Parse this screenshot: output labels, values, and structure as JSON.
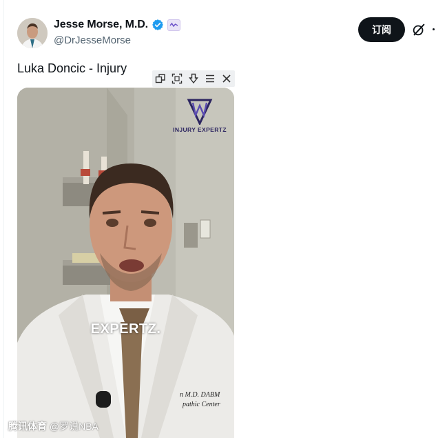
{
  "author": {
    "display_name": "Jesse Morse, M.D.",
    "handle": "@DrJesseMorse",
    "avatar_icon": "avatar-photo",
    "verified_icon": "verified-check-icon",
    "affiliate_icon": "affiliate-badge-icon"
  },
  "actions": {
    "subscribe_label": "订阅",
    "grok_icon": "grok-icon",
    "more_icon": "more-icon"
  },
  "tweet": {
    "text": "Luka Doncic - Injury"
  },
  "video": {
    "caption": "EXPERTZ.",
    "logo_text": "INJURY EXPERTZ",
    "coat_text_1": "n M.D. DABM",
    "coat_text_2": "pathic Center"
  },
  "video_toolbar": {
    "icons": [
      "popout-icon",
      "fullscreen-icon",
      "download-icon",
      "menu-icon",
      "close-icon"
    ]
  },
  "watermark": {
    "text_bold": "腾讯体育",
    "text_thin": "@罗说NBA"
  },
  "colors": {
    "accent": "#0f1419",
    "verified_blue": "#1d9bf0",
    "secondary_text": "#536471",
    "logo_purple": "#2c2560"
  }
}
